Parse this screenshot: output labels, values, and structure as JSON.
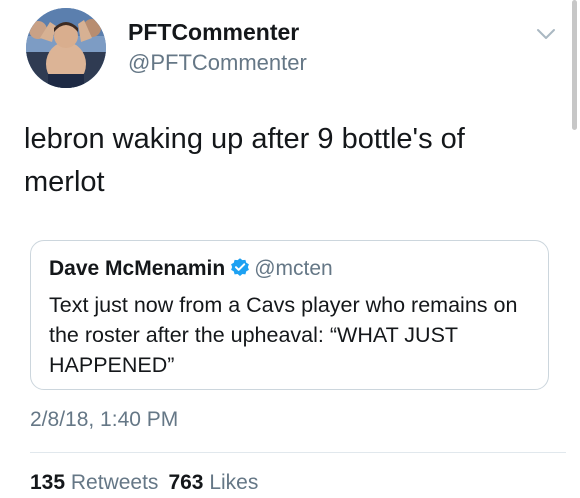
{
  "tweet": {
    "author": {
      "display_name": "PFTCommenter",
      "handle": "@PFTCommenter",
      "avatar_icon": "profile-photo"
    },
    "text": "lebron waking up after 9 bottle's of\nmerlot",
    "timestamp": "2/8/18, 1:40 PM",
    "menu_icon": "chevron-down-icon"
  },
  "quoted_tweet": {
    "display_name": "Dave McMenamin",
    "verified_icon": "verified-badge-icon",
    "handle": "@mcten",
    "text": "Text just now from a Cavs player who remains on the roster after the upheaval: “WHAT JUST HAPPENED”"
  },
  "stats": {
    "retweets_count": "135",
    "retweets_label": "Retweets",
    "likes_count": "763",
    "likes_label": "Likes"
  },
  "colors": {
    "text_primary": "#14171a",
    "text_secondary": "#657786",
    "verified_blue": "#1da1f2",
    "border": "#ccd6dd"
  }
}
